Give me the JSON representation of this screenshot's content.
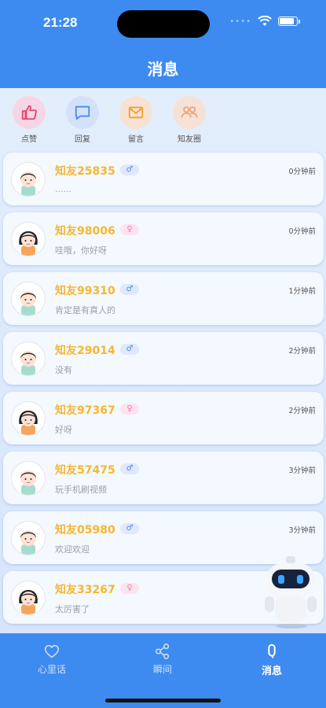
{
  "status": {
    "time": "21:28",
    "signal": "••••"
  },
  "header": {
    "title": "消息"
  },
  "categories": [
    {
      "label": "点赞",
      "icon": "thumbs-up-icon",
      "color": "#e8416e",
      "bg": "#f6d6e4"
    },
    {
      "label": "回复",
      "icon": "chat-bubble-icon",
      "color": "#4a8bf0",
      "bg": "#d3e2fb"
    },
    {
      "label": "留言",
      "icon": "envelope-icon",
      "color": "#f0a030",
      "bg": "#f6e2d2"
    },
    {
      "label": "知友圈",
      "icon": "group-icon",
      "color": "#f0a070",
      "bg": "#f5e1d6"
    }
  ],
  "messages": [
    {
      "name": "知友25835",
      "gender": "male",
      "gender_symbol": "♂",
      "time": "0分钟前",
      "text": "......"
    },
    {
      "name": "知友98006",
      "gender": "female",
      "gender_symbol": "♀",
      "time": "0分钟前",
      "text": "哇哦，你好呀"
    },
    {
      "name": "知友99310",
      "gender": "male",
      "gender_symbol": "♂",
      "time": "1分钟前",
      "text": "肯定是有真人的"
    },
    {
      "name": "知友29014",
      "gender": "male",
      "gender_symbol": "♂",
      "time": "2分钟前",
      "text": "没有"
    },
    {
      "name": "知友97367",
      "gender": "female",
      "gender_symbol": "♀",
      "time": "2分钟前",
      "text": "好呀"
    },
    {
      "name": "知友57475",
      "gender": "male",
      "gender_symbol": "♂",
      "time": "3分钟前",
      "text": "玩手机刷视频"
    },
    {
      "name": "知友05980",
      "gender": "male",
      "gender_symbol": "♂",
      "time": "3分钟前",
      "text": "欢迎欢迎"
    },
    {
      "name": "知友33267",
      "gender": "female",
      "gender_symbol": "♀",
      "time": "",
      "text": "太厉害了"
    }
  ],
  "tabs": [
    {
      "label": "心里话",
      "icon": "heart-outline-icon",
      "active": false
    },
    {
      "label": "瞬间",
      "icon": "share-icon",
      "active": false
    },
    {
      "label": "消息",
      "icon": "message-icon",
      "active": true
    }
  ],
  "colors": {
    "brand": "#3d8bf0",
    "name": "#f5b732",
    "male": "#4a8bf0",
    "female": "#f07aa7"
  }
}
